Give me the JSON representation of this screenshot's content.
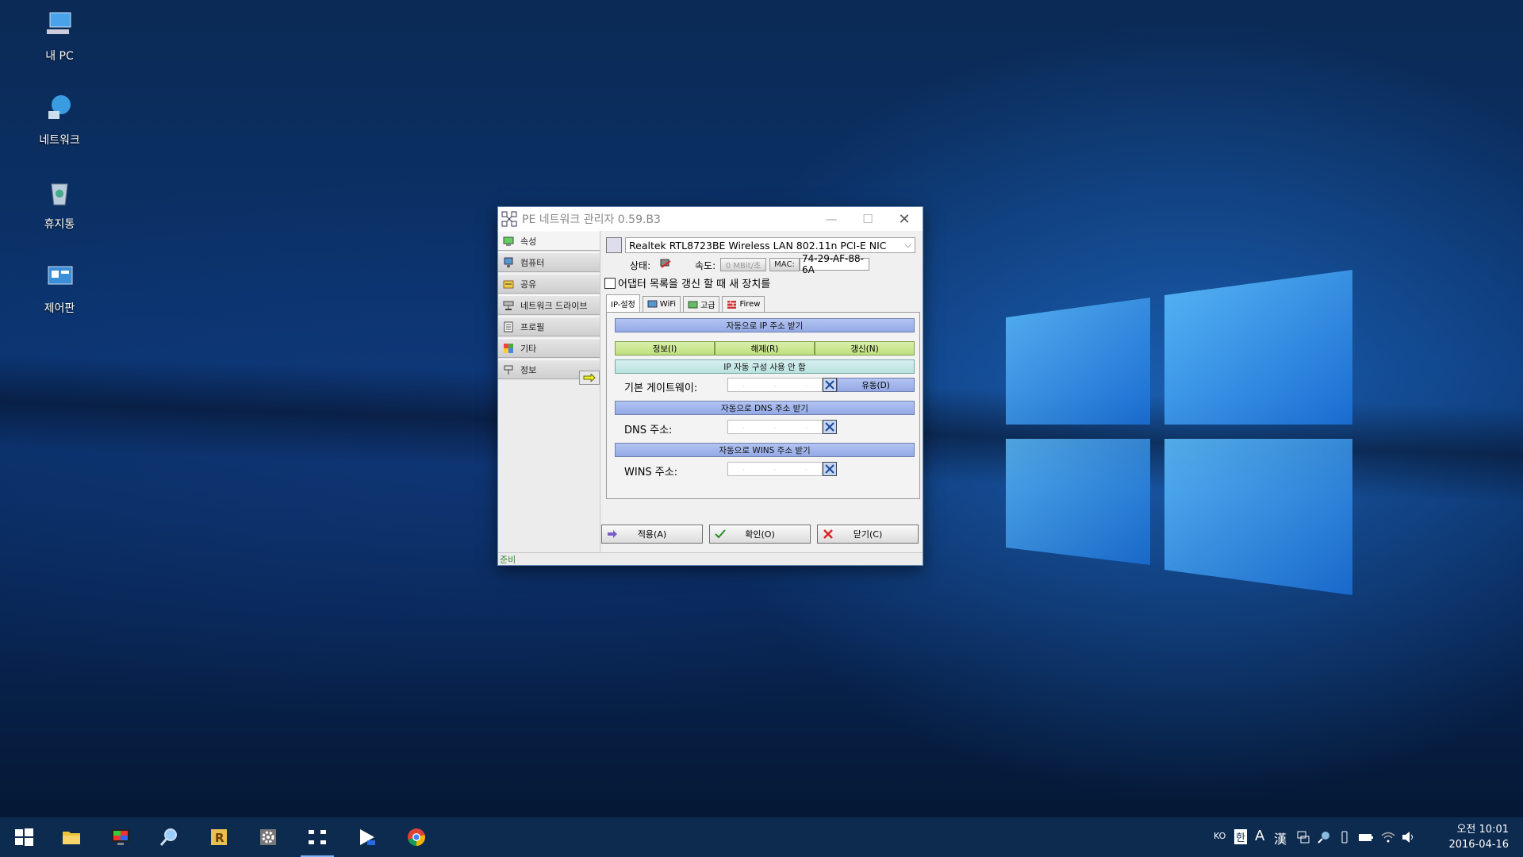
{
  "desktop": {
    "icons": [
      {
        "label": "내 PC",
        "icon": "computer-icon"
      },
      {
        "label": "네트워크",
        "icon": "network-icon"
      },
      {
        "label": "휴지통",
        "icon": "recycle-bin-icon"
      },
      {
        "label": "제어판",
        "icon": "control-panel-icon"
      }
    ]
  },
  "window": {
    "title": "PE 네트워크 관리자 0.59.B3",
    "nav": [
      {
        "label": "속성"
      },
      {
        "label": "컴퓨터"
      },
      {
        "label": "공유"
      },
      {
        "label": "네트워크 드라이브"
      },
      {
        "label": "프로필"
      },
      {
        "label": "기타"
      },
      {
        "label": "정보"
      }
    ],
    "adapter": "Realtek RTL8723BE Wireless LAN 802.11n PCI-E NIC",
    "status_label": "상태:",
    "speed_label": "속도:",
    "speed_value": "0 MBit/초",
    "mac_label": "MAC:",
    "mac_value": "74-29-AF-88-6A",
    "refresh_checkbox": "어댑터 목록을 갱신 할 때 새 장치를",
    "tabs": [
      "IP-설정",
      "WiFi",
      "고급",
      "Firew"
    ],
    "ip": {
      "auto_ip": "자동으로 IP 주소 받기",
      "info": "정보(I)",
      "release": "해제(R)",
      "renew": "갱신(N)",
      "no_autoconfig": "IP 자동 구성 사용 안 함",
      "gateway_label": "기본 게이트웨이:",
      "dynamic": "유동(D)",
      "auto_dns": "자동으로 DNS 주소 받기",
      "dns_label": "DNS 주소:",
      "auto_wins": "자동으로 WINS 주소 받기",
      "wins_label": "WINS 주소:"
    },
    "buttons": {
      "apply": "적용(A)",
      "ok": "확인(O)",
      "close": "닫기(C)"
    },
    "statusbar": "준비"
  },
  "taskbar": {
    "lang": "KO",
    "ime1": "한",
    "ime2": "A",
    "ime3": "漢",
    "time": "오전 10:01",
    "date": "2016-04-16"
  },
  "colors": {
    "accent": "#0d2a4f",
    "bar_blue": "#a3b6ec",
    "bar_green": "#cbe690"
  }
}
